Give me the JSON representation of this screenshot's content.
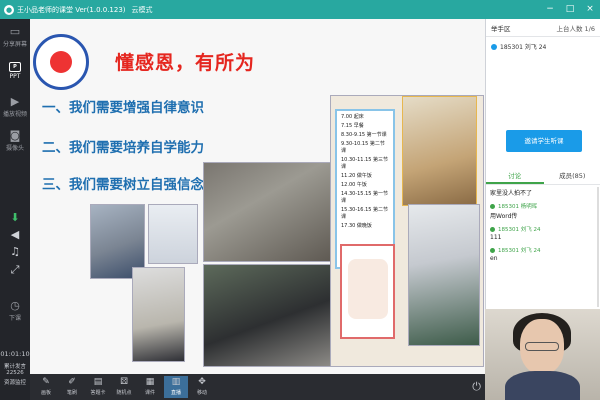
{
  "window": {
    "title": "王小品老师的课堂 Ver(1.0.0.123)",
    "mode": "云模式",
    "controls": [
      "−",
      "□",
      "×"
    ]
  },
  "sidebar": {
    "items": [
      {
        "label": "分享屏幕",
        "icon": "screen-share-icon"
      },
      {
        "label": "PPT",
        "icon": "ppt-icon"
      },
      {
        "label": "播放视频",
        "icon": "play-video-icon"
      },
      {
        "label": "摄像头",
        "icon": "camera-icon"
      }
    ],
    "tools": [
      "microphone-icon",
      "volume-icon",
      "music-icon",
      "expand-icon"
    ],
    "exit_label": "下课",
    "time": "01:01:10",
    "stat1": "累计发言",
    "stat2": "22526",
    "stat3": "资源监控"
  },
  "slide": {
    "title": "懂感恩，有所为",
    "points": [
      "一、我们需要增强自律意识",
      "二、我们需要培养自学能力",
      "三、我们需要树立自强信念"
    ],
    "schedule": [
      "7.00 起床",
      "7.15 早餐",
      "8.30-9.15 第一节课",
      "9.30-10.15 第二节课",
      "10.30-11.15 第三节课",
      "11.20 做午饭",
      "12.00 午饭",
      "14.30-15.15 第一节课",
      "15.30-16.15 第二节课",
      "17.30 做晚饭"
    ]
  },
  "bottom_toolbar": {
    "items": [
      {
        "label": "画板",
        "icon": "draw-board-icon"
      },
      {
        "label": "笔刷",
        "icon": "brush-icon"
      },
      {
        "label": "答题卡",
        "icon": "answer-card-icon"
      },
      {
        "label": "随机点",
        "icon": "random-pick-icon"
      },
      {
        "label": "课件",
        "icon": "courseware-icon"
      },
      {
        "label": "直播",
        "icon": "live-icon"
      },
      {
        "label": "移动",
        "icon": "move-icon"
      }
    ]
  },
  "right_panel": {
    "raise_hand_title": "举手区",
    "online_count": "上台人数 1/6",
    "hand_user": "185301 刘飞 24",
    "listen_button": "邀请学生听课",
    "tabs": [
      "讨论",
      "成员(85)"
    ],
    "chat": [
      {
        "name": "",
        "text": "家里没人拍不了"
      },
      {
        "name": "185301 杨明晖",
        "text": "用Word传"
      },
      {
        "name": "185301 刘飞 24",
        "text": "111"
      },
      {
        "name": "185301 刘飞 24",
        "text": "en"
      }
    ]
  },
  "colors": {
    "titlebar": "#28a8a0",
    "accent_blue": "#1a9be8",
    "title_red": "#e5261f",
    "point_blue": "#1f6fb0",
    "chat_green": "#3fa44a"
  }
}
